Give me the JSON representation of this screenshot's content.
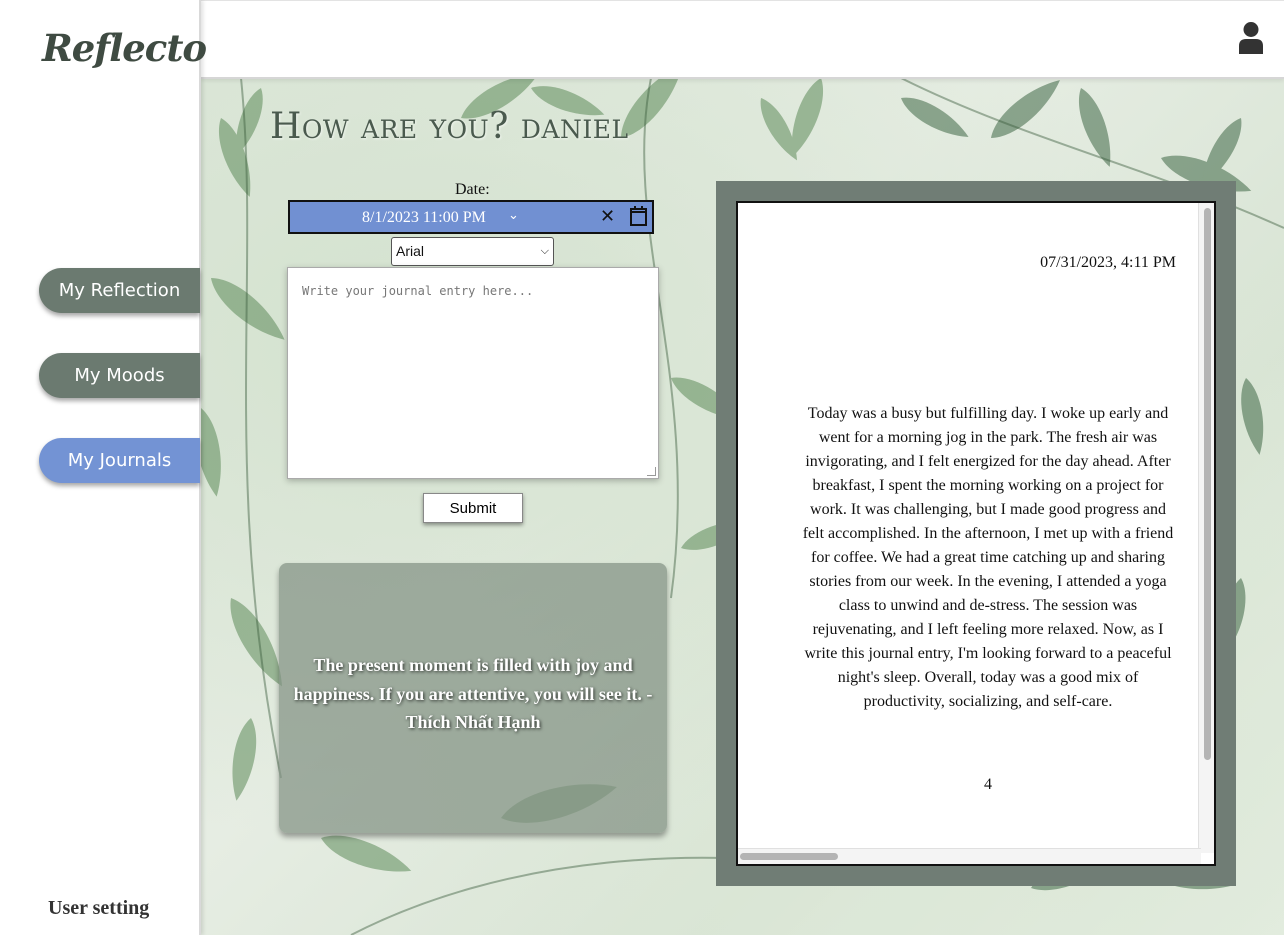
{
  "app": {
    "logo": "Reflecto"
  },
  "sidebar": {
    "items": [
      {
        "label": "My Reflection"
      },
      {
        "label": "My Moods"
      },
      {
        "label": "My Journals"
      }
    ],
    "user_setting": "User setting"
  },
  "header": {
    "user_icon": "user-icon"
  },
  "main": {
    "greeting": "How are you? daniel",
    "date_label": "Date:",
    "date_value": "8/1/2023 11:00  PM",
    "font_select": "Arial",
    "entry_placeholder": "Write your journal entry here...",
    "submit_label": "Submit",
    "quote": "The present moment is filled with joy and happiness. If you are attentive, you will see it. - Thích Nhất Hạnh"
  },
  "journal": {
    "date": "07/31/2023, 4:11 PM",
    "body": "Today was a busy but fulfilling day. I woke up early and went for a morning jog in the park. The fresh air was invigorating, and I felt energized for the day ahead. After breakfast, I spent the morning working on a project for work. It was challenging, but I made good progress and felt accomplished. In the afternoon, I met up with a friend for coffee. We had a great time catching up and sharing stories from our week. In the evening, I attended a yoga class to unwind and de-stress. The session was rejuvenating, and I left feeling more relaxed. Now, as I write this journal entry, I'm looking forward to a peaceful night's sleep. Overall, today was a good mix of productivity, socializing, and self-care.",
    "page_number": "4"
  },
  "colors": {
    "nav_dark": "#6b7a70",
    "nav_active": "#7393d4",
    "date_bg": "#7190d2",
    "frame": "#707d75"
  }
}
